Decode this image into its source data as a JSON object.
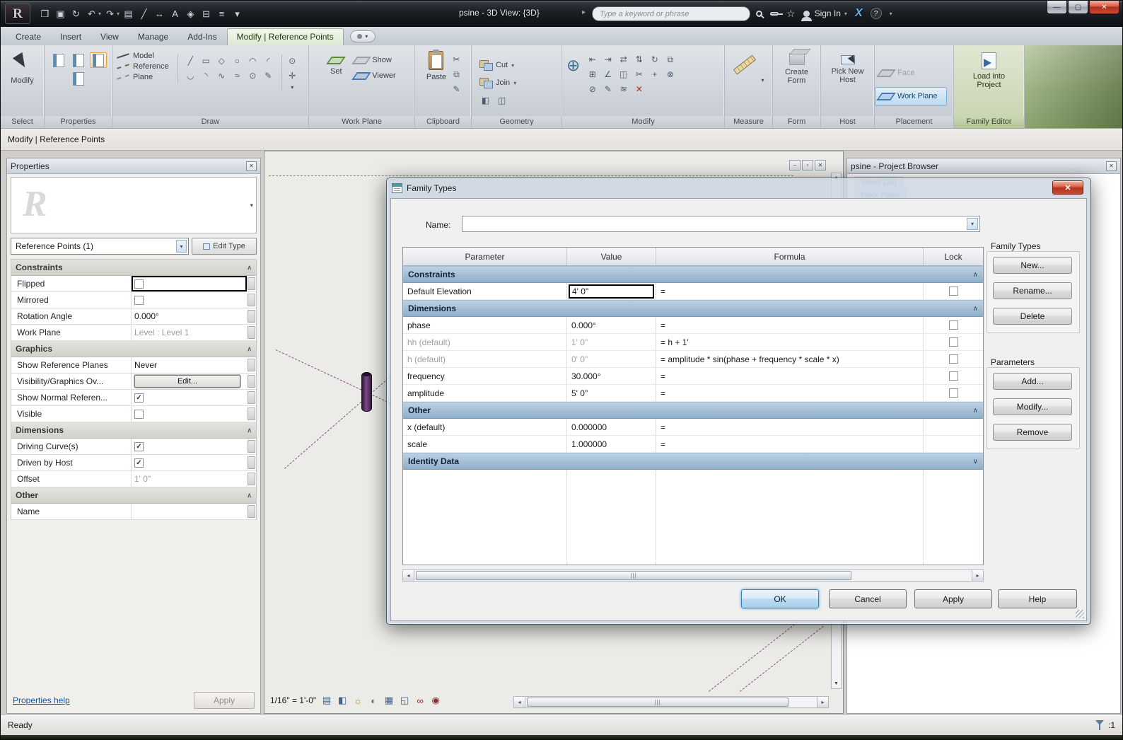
{
  "titlebar": {
    "app_letter": "R",
    "title": "psine - 3D View: {3D}",
    "search_placeholder": "Type a keyword or phrase",
    "sign_in": "Sign In",
    "qat": [
      {
        "name": "open-icon",
        "glyph": "❒"
      },
      {
        "name": "save-icon",
        "glyph": "▣"
      },
      {
        "name": "sync-icon",
        "glyph": "↻"
      },
      {
        "name": "undo-icon",
        "glyph": "↶",
        "dropdown": true
      },
      {
        "name": "redo-icon",
        "glyph": "↷",
        "dropdown": true
      },
      {
        "name": "print-icon",
        "glyph": "▤"
      },
      {
        "name": "measure-icon",
        "glyph": "╱"
      },
      {
        "name": "aligned-dimension-icon",
        "glyph": "↔"
      },
      {
        "name": "text-icon",
        "glyph": "A"
      },
      {
        "name": "default-3d-view-icon",
        "glyph": "◈"
      },
      {
        "name": "section-icon",
        "glyph": "⊟"
      },
      {
        "name": "thin-lines-icon",
        "glyph": "≡"
      },
      {
        "name": "qat-customize-icon",
        "glyph": "▾"
      }
    ]
  },
  "ribbon": {
    "tabs": [
      "Create",
      "Insert",
      "View",
      "Manage",
      "Add-Ins",
      "Modify | Reference Points"
    ],
    "active_tab": "Modify | Reference Points",
    "panel_labels": {
      "select": "Select",
      "properties": "Properties",
      "draw": "Draw",
      "work_plane": "Work Plane",
      "clipboard": "Clipboard",
      "geometry": "Geometry",
      "modify": "Modify",
      "measure": "Measure",
      "form": "Form",
      "host": "Host",
      "placement": "Placement",
      "family_editor": "Family Editor"
    },
    "buttons": {
      "modify": "Modify",
      "model": "Model",
      "reference": "Reference",
      "plane": "Plane",
      "set": "Set",
      "show": "Show",
      "viewer": "Viewer",
      "paste": "Paste",
      "cut": "Cut",
      "join": "Join",
      "create_form": "Create Form",
      "pick_new_host": "Pick New Host",
      "face": "Face",
      "work_plane": "Work Plane",
      "load_into_project": "Load into Project"
    },
    "draw_tools": [
      {
        "name": "line-tool-icon",
        "glyph": "╱"
      },
      {
        "name": "rectangle-tool-icon",
        "glyph": "▭"
      },
      {
        "name": "polygon-tool-icon",
        "glyph": "◇"
      },
      {
        "name": "circle-tool-icon",
        "glyph": "○"
      },
      {
        "name": "arc-tool-icon",
        "glyph": "◠"
      },
      {
        "name": "tangent-arc-tool-icon",
        "glyph": "◜"
      },
      {
        "name": "fillet-arc-tool-icon",
        "glyph": "◡"
      },
      {
        "name": "center-arc-tool-icon",
        "glyph": "◝"
      },
      {
        "name": "spline-tool-icon",
        "glyph": "∿"
      },
      {
        "name": "ellipse-tool-icon",
        "glyph": "≈"
      },
      {
        "name": "point-element-tool-icon",
        "glyph": "⊙"
      },
      {
        "name": "pick-lines-tool-icon",
        "glyph": "✎"
      }
    ],
    "modify_tools": [
      {
        "name": "align-icon",
        "glyph": "⇤"
      },
      {
        "name": "offset-icon",
        "glyph": "⇥"
      },
      {
        "name": "mirror-axis-icon",
        "glyph": "⇄"
      },
      {
        "name": "mirror-pick-icon",
        "glyph": "⇅"
      },
      {
        "name": "rotate-icon",
        "glyph": "↻"
      },
      {
        "name": "copy-icon",
        "glyph": "⧉"
      },
      {
        "name": "array-icon",
        "glyph": "⊞"
      },
      {
        "name": "scale-icon",
        "glyph": "∠"
      },
      {
        "name": "trim-extend-icon",
        "glyph": "◫"
      },
      {
        "name": "split-icon",
        "glyph": "✂"
      },
      {
        "name": "move-icon",
        "glyph": "+"
      },
      {
        "name": "pin-icon",
        "glyph": "⊗"
      },
      {
        "name": "unpin-icon",
        "glyph": "⊘"
      },
      {
        "name": "paint-icon",
        "glyph": "✎"
      },
      {
        "name": "demolish-icon",
        "glyph": "≋"
      },
      {
        "name": "delete-icon",
        "glyph": "✕",
        "color": "#b03028"
      }
    ]
  },
  "mode_bar": {
    "label": "Modify | Reference Points"
  },
  "properties": {
    "title": "Properties",
    "type_selector": "Reference Points (1)",
    "edit_type_label": "Edit Type",
    "rows": [
      {
        "kind": "group",
        "label": "Constraints"
      },
      {
        "kind": "prop",
        "label": "Flipped",
        "control": "checkbox",
        "checked": false,
        "selected": true
      },
      {
        "kind": "prop",
        "label": "Mirrored",
        "control": "checkbox",
        "checked": false
      },
      {
        "kind": "prop",
        "label": "Rotation Angle",
        "value": "0.000°"
      },
      {
        "kind": "prop",
        "label": "Work Plane",
        "value": "Level : Level 1",
        "disabled": true
      },
      {
        "kind": "group",
        "label": "Graphics"
      },
      {
        "kind": "prop",
        "label": "Show Reference Planes",
        "value": "Never"
      },
      {
        "kind": "prop",
        "label": "Visibility/Graphics Ov...",
        "control": "button",
        "value": "Edit..."
      },
      {
        "kind": "prop",
        "label": "Show Normal Referen...",
        "control": "checkbox",
        "checked": true
      },
      {
        "kind": "prop",
        "label": "Visible",
        "control": "checkbox",
        "checked": false
      },
      {
        "kind": "group",
        "label": "Dimensions"
      },
      {
        "kind": "prop",
        "label": "Driving Curve(s)",
        "control": "checkbox",
        "checked": true
      },
      {
        "kind": "prop",
        "label": "Driven by Host",
        "control": "checkbox",
        "checked": true
      },
      {
        "kind": "prop",
        "label": "Offset",
        "value": "1'  0\"",
        "disabled": true
      },
      {
        "kind": "group",
        "label": "Other"
      },
      {
        "kind": "prop",
        "label": "Name",
        "value": ""
      }
    ],
    "help_link": "Properties help",
    "apply_label": "Apply"
  },
  "viewport": {
    "scale": "1/16\" = 1'-0\"",
    "view_icons": [
      {
        "name": "detail-level-icon",
        "glyph": "▤",
        "color": "#3f618f"
      },
      {
        "name": "visual-style-icon",
        "glyph": "◧",
        "color": "#3f618f"
      },
      {
        "name": "sun-path-icon",
        "glyph": "☼",
        "color": "#b08a2e"
      },
      {
        "name": "shadows-icon",
        "glyph": "◐",
        "color": "#5f666e"
      },
      {
        "name": "crop-view-icon",
        "glyph": "▦",
        "color": "#3f618f"
      },
      {
        "name": "show-crop-icon",
        "glyph": "◱",
        "color": "#3f618f"
      },
      {
        "name": "temporary-hide-icon",
        "glyph": "∞",
        "color": "#8a2a2a"
      },
      {
        "name": "reveal-hidden-icon",
        "glyph": "◉",
        "color": "#8a2a2a"
      }
    ]
  },
  "project_browser": {
    "title": "psine - Project Browser",
    "items": [
      "Views (all)",
      "Floor Plans"
    ]
  },
  "dialog": {
    "title": "Family Types",
    "name_label": "Name:",
    "name_value": "",
    "columns": [
      "Parameter",
      "Value",
      "Formula",
      "Lock"
    ],
    "rows": [
      {
        "kind": "group",
        "label": "Constraints",
        "chevron": "up"
      },
      {
        "kind": "param",
        "parameter": "Default Elevation",
        "value": "4'  0\"",
        "formula": "=",
        "lock": true,
        "value_selected": true
      },
      {
        "kind": "group",
        "label": "Dimensions",
        "chevron": "up"
      },
      {
        "kind": "param",
        "parameter": "phase",
        "value": "0.000°",
        "formula": "=",
        "lock": true
      },
      {
        "kind": "param",
        "parameter": "hh (default)",
        "value": "1'  0\"",
        "formula": "= h + 1'",
        "lock": true,
        "dim": true
      },
      {
        "kind": "param",
        "parameter": "h (default)",
        "value": "0'  0\"",
        "formula": "= amplitude * sin(phase + frequency * scale * x)",
        "lock": true,
        "dim": true
      },
      {
        "kind": "param",
        "parameter": "frequency",
        "value": "30.000°",
        "formula": "=",
        "lock": true
      },
      {
        "kind": "param",
        "parameter": "amplitude",
        "value": "5'  0\"",
        "formula": "=",
        "lock": true
      },
      {
        "kind": "group",
        "label": "Other",
        "chevron": "up"
      },
      {
        "kind": "param",
        "parameter": "x (default)",
        "value": "0.000000",
        "formula": "=",
        "lock": false
      },
      {
        "kind": "param",
        "parameter": "scale",
        "value": "1.000000",
        "formula": "=",
        "lock": false
      },
      {
        "kind": "group",
        "label": "Identity Data",
        "chevron": "down"
      }
    ],
    "side": {
      "family_types_label": "Family Types",
      "new_label": "New...",
      "rename_label": "Rename...",
      "delete_label": "Delete",
      "parameters_label": "Parameters",
      "add_label": "Add...",
      "modify_label": "Modify...",
      "remove_label": "Remove"
    },
    "footer": {
      "ok": "OK",
      "cancel": "Cancel",
      "apply": "Apply",
      "help": "Help"
    }
  },
  "statusbar": {
    "ready": "Ready",
    "zoom_label": ":1"
  }
}
